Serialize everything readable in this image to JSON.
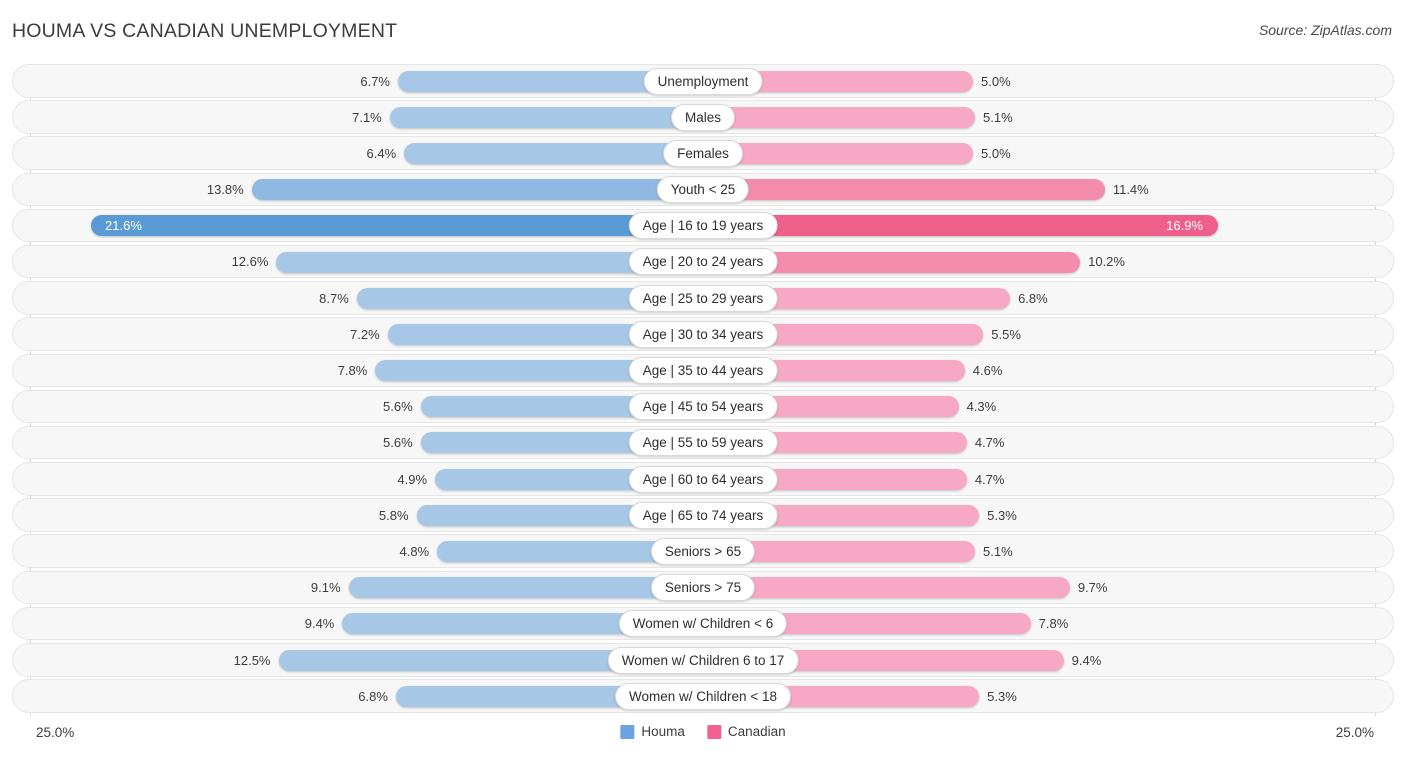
{
  "header": {
    "title": "HOUMA VS CANADIAN UNEMPLOYMENT",
    "source": "Source: ZipAtlas.com"
  },
  "axis": {
    "min_label": "25.0%",
    "max_label": "25.0%"
  },
  "legend": {
    "items": [
      {
        "label": "Houma",
        "color": "#6aa3e0"
      },
      {
        "label": "Canadian",
        "color": "#f2628f"
      }
    ]
  },
  "colors": {
    "houma_light": "#a7c7e7",
    "houma_mid": "#8fb8e2",
    "houma_dark": "#5b9bd5",
    "canadian_light": "#f7a8c4",
    "canadian_mid": "#f48cae",
    "canadian_dark": "#ef5f8c",
    "row_background": "#f7f7f7",
    "row_border": "#e6e6e6",
    "axis_line": "#d8d8d8",
    "text": "#3d3d3d"
  },
  "chart_data": {
    "type": "bar",
    "orientation": "horizontal-diverging",
    "title": "HOUMA VS CANADIAN UNEMPLOYMENT",
    "subtitle": "",
    "xlabel": "",
    "ylabel": "",
    "source": "Source: ZipAtlas.com",
    "unit": "%",
    "xlim": [
      25.0,
      25.0
    ],
    "grid": false,
    "legend_position": "bottom-center",
    "categories": [
      "Unemployment",
      "Males",
      "Females",
      "Youth < 25",
      "Age | 16 to 19 years",
      "Age | 20 to 24 years",
      "Age | 25 to 29 years",
      "Age | 30 to 34 years",
      "Age | 35 to 44 years",
      "Age | 45 to 54 years",
      "Age | 55 to 59 years",
      "Age | 60 to 64 years",
      "Age | 65 to 74 years",
      "Seniors > 65",
      "Seniors > 75",
      "Women w/ Children < 6",
      "Women w/ Children 6 to 17",
      "Women w/ Children < 18"
    ],
    "series": [
      {
        "name": "Houma",
        "color": "#6aa3e0",
        "values": [
          6.7,
          7.1,
          6.4,
          13.8,
          21.6,
          12.6,
          8.7,
          7.2,
          7.8,
          5.6,
          5.6,
          4.9,
          5.8,
          4.8,
          9.1,
          9.4,
          12.5,
          6.8
        ]
      },
      {
        "name": "Canadian",
        "color": "#f2628f",
        "values": [
          5.0,
          5.1,
          5.0,
          11.4,
          16.9,
          10.2,
          6.8,
          5.5,
          4.6,
          4.3,
          4.7,
          4.7,
          5.3,
          5.1,
          9.7,
          7.8,
          9.4,
          5.3
        ]
      }
    ]
  },
  "rows": [
    {
      "label": "Unemployment",
      "left_value": "6.7%",
      "right_value": "5.0%"
    },
    {
      "label": "Males",
      "left_value": "7.1%",
      "right_value": "5.1%"
    },
    {
      "label": "Females",
      "left_value": "6.4%",
      "right_value": "5.0%"
    },
    {
      "label": "Youth < 25",
      "left_value": "13.8%",
      "right_value": "11.4%"
    },
    {
      "label": "Age | 16 to 19 years",
      "left_value": "21.6%",
      "right_value": "16.9%"
    },
    {
      "label": "Age | 20 to 24 years",
      "left_value": "12.6%",
      "right_value": "10.2%"
    },
    {
      "label": "Age | 25 to 29 years",
      "left_value": "8.7%",
      "right_value": "6.8%"
    },
    {
      "label": "Age | 30 to 34 years",
      "left_value": "7.2%",
      "right_value": "5.5%"
    },
    {
      "label": "Age | 35 to 44 years",
      "left_value": "7.8%",
      "right_value": "4.6%"
    },
    {
      "label": "Age | 45 to 54 years",
      "left_value": "5.6%",
      "right_value": "4.3%"
    },
    {
      "label": "Age | 55 to 59 years",
      "left_value": "5.6%",
      "right_value": "4.7%"
    },
    {
      "label": "Age | 60 to 64 years",
      "left_value": "4.9%",
      "right_value": "4.7%"
    },
    {
      "label": "Age | 65 to 74 years",
      "left_value": "5.8%",
      "right_value": "5.3%"
    },
    {
      "label": "Seniors > 65",
      "left_value": "4.8%",
      "right_value": "5.1%"
    },
    {
      "label": "Seniors > 75",
      "left_value": "9.1%",
      "right_value": "9.7%"
    },
    {
      "label": "Women w/ Children < 6",
      "left_value": "9.4%",
      "right_value": "7.8%"
    },
    {
      "label": "Women w/ Children 6 to 17",
      "left_value": "12.5%",
      "right_value": "9.4%"
    },
    {
      "label": "Women w/ Children < 18",
      "left_value": "6.8%",
      "right_value": "5.3%"
    }
  ]
}
